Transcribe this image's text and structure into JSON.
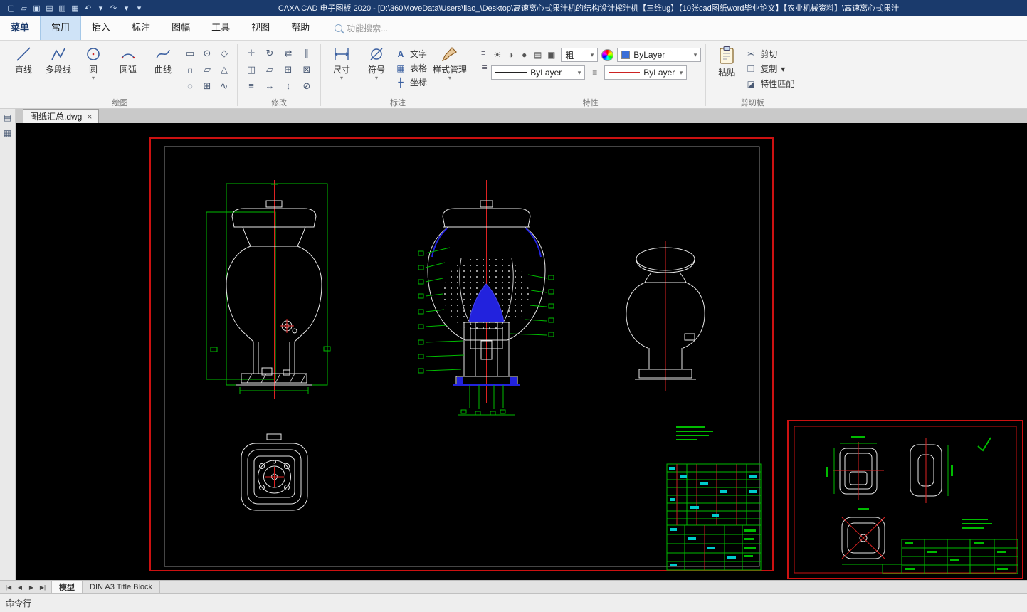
{
  "colors": {
    "titlebar_bg": "#1a3a6c",
    "canvas_bg": "#000000",
    "frame_red": "#cc1111",
    "drawing_white": "#e8e8e8",
    "dimension_green": "#00bb00",
    "highlight_blue": "#2222dd",
    "centerline_red": "#dd2222",
    "table_cyan": "#00cccc",
    "active_tab_bg": "#cfe3f7"
  },
  "ui": {
    "dropdown_arrow": "▾"
  },
  "titlebar": {
    "title": "CAXA CAD 电子图板 2020 - [D:\\360MoveData\\Users\\liao_\\Desktop\\高速离心式果汁机的结构设计榨汁机【三维ug】【10张cad图纸word毕业论文】【农业机械资料】\\高速离心式果汁",
    "quick_icons": [
      {
        "name": "new",
        "glyph": "▢"
      },
      {
        "name": "open",
        "glyph": "▱"
      },
      {
        "name": "save",
        "glyph": "▣"
      },
      {
        "name": "plot-preview",
        "glyph": "▤"
      },
      {
        "name": "save-as",
        "glyph": "▥"
      },
      {
        "name": "print",
        "glyph": "▦"
      },
      {
        "name": "undo",
        "glyph": "↶"
      },
      {
        "name": "undo-dropdown",
        "glyph": "▾"
      },
      {
        "name": "redo",
        "glyph": "↷"
      },
      {
        "name": "redo-dropdown",
        "glyph": "▾"
      },
      {
        "name": "customize-toolbar",
        "glyph": "▾"
      }
    ]
  },
  "menu": {
    "tabs": [
      "菜单",
      "常用",
      "插入",
      "标注",
      "图幅",
      "工具",
      "视图",
      "帮助"
    ],
    "active_tab": "常用",
    "search_placeholder": "功能搜索..."
  },
  "ribbon": {
    "draw": {
      "label": "绘图",
      "tools": [
        "直线",
        "多段线",
        "圆",
        "圆弧",
        "曲线"
      ],
      "grid_icons": [
        "▭",
        "⊙",
        "◇",
        "∩",
        "▱",
        "△",
        "◌",
        "⊞",
        "∿"
      ]
    },
    "modify": {
      "label": "修改",
      "grid_icons": [
        "✛",
        "↻",
        "⇄",
        "∥",
        "◫",
        "▱",
        "⊞",
        "⊠",
        "≡",
        "↔",
        "↕",
        "⊘"
      ]
    },
    "annotate": {
      "label": "标注",
      "dimension": "尺寸",
      "symbol": "符号",
      "text": "文字",
      "table": "表格",
      "coordinate": "坐标",
      "style_manager": "样式管理",
      "text_icon": "A",
      "table_icon": "▦",
      "coordinate_icon": "╋"
    },
    "props": {
      "label": "特性",
      "small_icons": [
        {
          "name": "sun",
          "glyph": "☀"
        },
        {
          "name": "half-circle",
          "glyph": "◑"
        },
        {
          "name": "dot",
          "glyph": "●"
        },
        {
          "name": "rows",
          "glyph": "▤"
        },
        {
          "name": "square",
          "glyph": "▣"
        }
      ],
      "linewidth": "粗",
      "layer_value": "ByLayer",
      "linetype_value": "ByLayer",
      "color_value": "ByLayer"
    },
    "clipboard": {
      "label": "剪切板",
      "paste": "粘贴",
      "cut": "剪切",
      "copy": "复制",
      "match": "特性匹配",
      "cut_icon": "✂",
      "copy_icon": "❐",
      "match_icon": "◪"
    }
  },
  "doctab": {
    "label": "图纸汇总.dwg",
    "close_glyph": "×"
  },
  "left_panel_icons": [
    {
      "name": "layout-panel",
      "glyph": "▤"
    },
    {
      "name": "grid-panel",
      "glyph": "▦"
    }
  ],
  "sheetbar": {
    "nav": [
      "|◀",
      "◀",
      "▶",
      "▶|"
    ],
    "tabs": [
      "模型",
      "DIN A3 Title Block"
    ],
    "active_tab": "模型"
  },
  "cmdline": {
    "label": "命令行"
  }
}
